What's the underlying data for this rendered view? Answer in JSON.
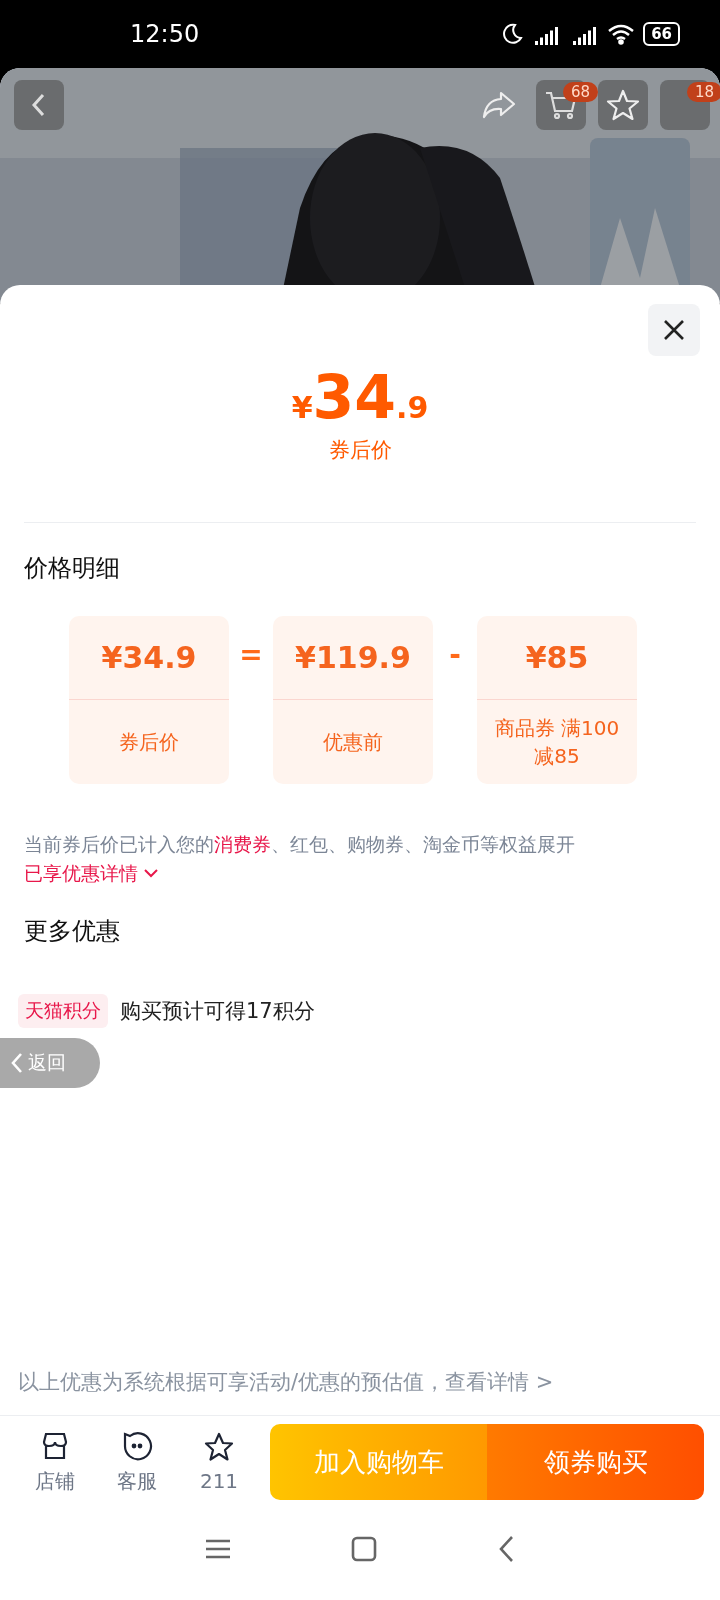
{
  "status_bar": {
    "time": "12:50",
    "battery": "66"
  },
  "header": {
    "cart_badge": "68",
    "menu_badge": "18"
  },
  "price": {
    "currency": "¥",
    "integer": "34",
    "decimal": ".9",
    "label": "券后价"
  },
  "breakdown": {
    "title": "价格明细",
    "items": [
      {
        "amount": "¥34.9",
        "label": "券后价"
      },
      {
        "operator": "=",
        "amount": "¥119.9",
        "label": "优惠前"
      },
      {
        "operator": "-",
        "amount": "¥85",
        "label": "商品券 满100减85"
      }
    ]
  },
  "note": {
    "parts": [
      {
        "text": "当前券后价已计入您的",
        "highlight": false
      },
      {
        "text": "消费券",
        "highlight": true
      },
      {
        "text": "、红包、购物券、淘金币等权益展开",
        "highlight": false
      }
    ],
    "link": "已享优惠详情"
  },
  "more": {
    "title": "更多优惠",
    "items": [
      {
        "tag": "天猫积分",
        "text": "购买预计可得17积分"
      }
    ]
  },
  "back_pill": "返回",
  "footer_note": "以上优惠为系统根据可享活动/优惠的预估值，查看详情 >",
  "bottom_bar": {
    "icons": [
      {
        "kind": "store",
        "label": "店铺"
      },
      {
        "kind": "chat",
        "label": "客服"
      },
      {
        "kind": "star",
        "label": "211"
      }
    ],
    "buttons": [
      {
        "kind": "cart",
        "label": "加入购物车"
      },
      {
        "kind": "buy",
        "label": "领券购买"
      }
    ]
  }
}
